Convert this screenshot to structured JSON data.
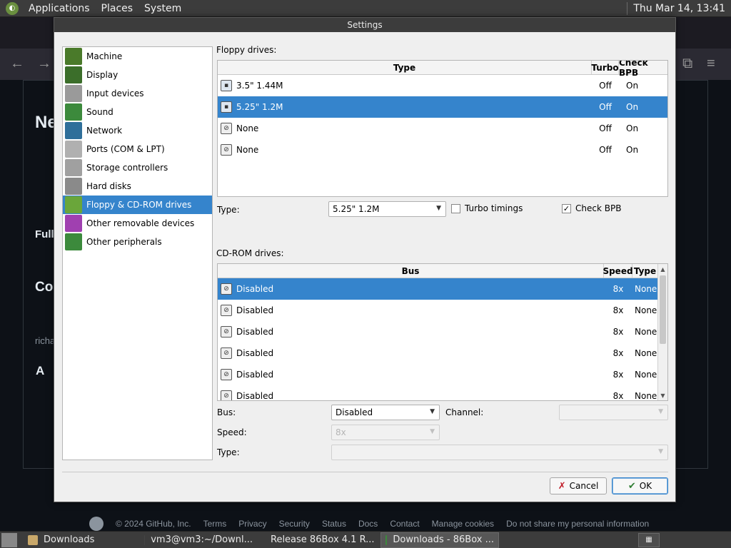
{
  "top_panel": {
    "menus": [
      "Applications",
      "Places",
      "System"
    ],
    "clock": "Thu Mar 14, 13:41"
  },
  "background": {
    "heading_partial": "Ne",
    "full_partial": "Full",
    "co_partial": "Co",
    "user_partial": "richa",
    "a_partial": "A",
    "footer": {
      "copyright": "© 2024 GitHub, Inc.",
      "links": [
        "Terms",
        "Privacy",
        "Security",
        "Status",
        "Docs",
        "Contact",
        "Manage cookies",
        "Do not share my personal information"
      ]
    }
  },
  "dialog": {
    "title": "Settings",
    "categories": [
      {
        "label": "Machine",
        "icon": "machine-icon",
        "color": "#4a7a2a",
        "selected": false
      },
      {
        "label": "Display",
        "icon": "display-icon",
        "color": "#3b6e2a",
        "selected": false
      },
      {
        "label": "Input devices",
        "icon": "input-devices-icon",
        "color": "#9a9a9a",
        "selected": false
      },
      {
        "label": "Sound",
        "icon": "sound-icon",
        "color": "#3c8a3c",
        "selected": false
      },
      {
        "label": "Network",
        "icon": "network-icon",
        "color": "#2f6f9a",
        "selected": false
      },
      {
        "label": "Ports (COM & LPT)",
        "icon": "ports-icon",
        "color": "#b0b0b0",
        "selected": false
      },
      {
        "label": "Storage controllers",
        "icon": "storage-controllers-icon",
        "color": "#a0a0a0",
        "selected": false
      },
      {
        "label": "Hard disks",
        "icon": "hard-disks-icon",
        "color": "#8a8a8a",
        "selected": false
      },
      {
        "label": "Floppy & CD-ROM drives",
        "icon": "floppy-cdrom-icon",
        "color": "#6aa63a",
        "selected": true
      },
      {
        "label": "Other removable devices",
        "icon": "removable-devices-icon",
        "color": "#a040b0",
        "selected": false
      },
      {
        "label": "Other peripherals",
        "icon": "peripherals-icon",
        "color": "#3c8a3c",
        "selected": false
      }
    ],
    "floppy": {
      "label": "Floppy drives:",
      "headers": {
        "type": "Type",
        "turbo": "Turbo",
        "check_bpb": "Check BPB"
      },
      "rows": [
        {
          "type": "3.5\" 1.44M",
          "turbo": "Off",
          "check_bpb": "On",
          "selected": false,
          "icon": "floppy-35-icon"
        },
        {
          "type": "5.25\" 1.2M",
          "turbo": "Off",
          "check_bpb": "On",
          "selected": true,
          "icon": "floppy-525-icon"
        },
        {
          "type": "None",
          "turbo": "Off",
          "check_bpb": "On",
          "selected": false,
          "icon": "floppy-none-icon"
        },
        {
          "type": "None",
          "turbo": "Off",
          "check_bpb": "On",
          "selected": false,
          "icon": "floppy-none-icon"
        }
      ],
      "type_label": "Type:",
      "type_value": "5.25\" 1.2M",
      "turbo_label": "Turbo timings",
      "turbo_checked": false,
      "check_bpb_label": "Check BPB",
      "check_bpb_checked": true
    },
    "cdrom": {
      "label": "CD-ROM drives:",
      "headers": {
        "bus": "Bus",
        "speed": "Speed",
        "type": "Type"
      },
      "rows": [
        {
          "bus": "Disabled",
          "speed": "8x",
          "type": "None",
          "selected": true
        },
        {
          "bus": "Disabled",
          "speed": "8x",
          "type": "None",
          "selected": false
        },
        {
          "bus": "Disabled",
          "speed": "8x",
          "type": "None",
          "selected": false
        },
        {
          "bus": "Disabled",
          "speed": "8x",
          "type": "None",
          "selected": false
        },
        {
          "bus": "Disabled",
          "speed": "8x",
          "type": "None",
          "selected": false
        },
        {
          "bus": "Disabled",
          "speed": "8x",
          "type": "None",
          "selected": false
        }
      ],
      "bus_label": "Bus:",
      "bus_value": "Disabled",
      "channel_label": "Channel:",
      "channel_value": "",
      "speed_label": "Speed:",
      "speed_value": "8x",
      "type_label": "Type:",
      "type_value": ""
    },
    "buttons": {
      "cancel": "Cancel",
      "ok": "OK"
    }
  },
  "taskbar": {
    "tasks": [
      {
        "label": "Downloads",
        "icon": "folder-icon",
        "active": false
      },
      {
        "label": "vm3@vm3:~/Downl...",
        "icon": "terminal-icon",
        "active": false
      },
      {
        "label": "Release 86Box 4.1 R...",
        "icon": "firefox-icon",
        "active": false
      },
      {
        "label": "Downloads - 86Box ...",
        "icon": "86box-icon",
        "active": true
      }
    ]
  }
}
